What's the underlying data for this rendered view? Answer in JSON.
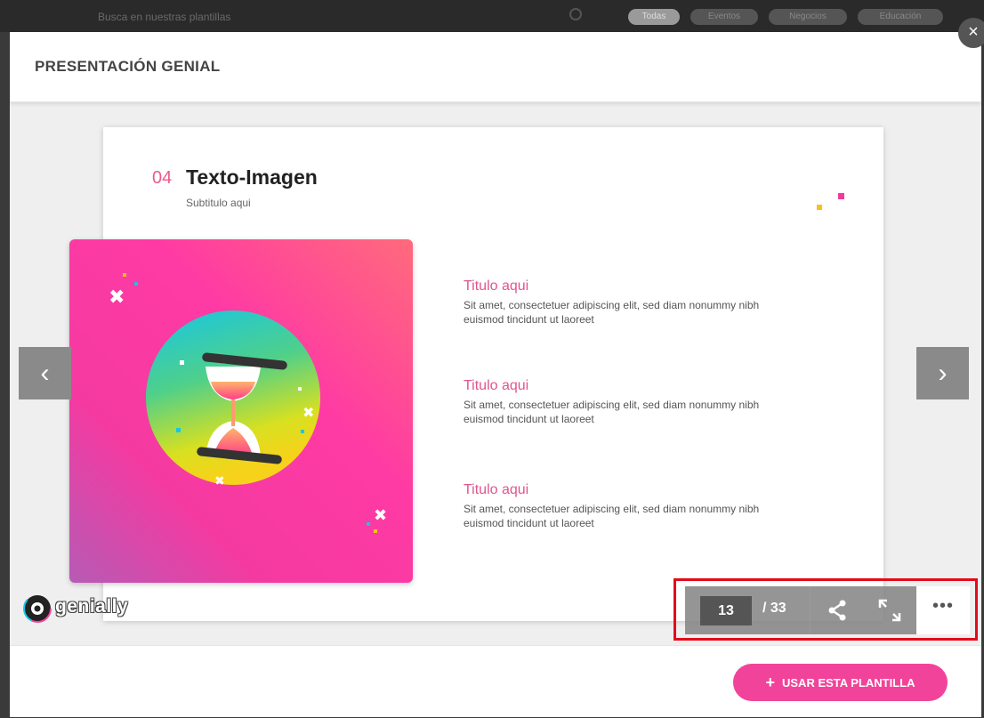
{
  "background": {
    "search_placeholder": "Busca en nuestras plantillas",
    "filters": [
      "Todas",
      "Eventos",
      "Negocios",
      "Educación"
    ]
  },
  "modal": {
    "title": "PRESENTACIÓN GENIAL",
    "close_label": "×"
  },
  "slide": {
    "number": "04",
    "heading": "Texto-Imagen",
    "subtitle": "Subtitulo aqui",
    "items": [
      {
        "title": "Titulo aqui",
        "body": "Sit amet, consectetuer adipiscing elit, sed diam nonummy nibh euismod tincidunt ut laoreet"
      },
      {
        "title": "Titulo aqui",
        "body": "Sit amet, consectetuer adipiscing elit, sed diam nonummy nibh euismod tincidunt ut laoreet"
      },
      {
        "title": "Titulo aqui",
        "body": "Sit amet, consectetuer adipiscing elit, sed diam nonummy nibh euismod tincidunt ut laoreet"
      }
    ]
  },
  "nav": {
    "prev_icon": "‹",
    "next_icon": "›"
  },
  "logo": {
    "text": "genially"
  },
  "toolbar": {
    "current_page": "13",
    "total_pages": "/ 33",
    "more_label": "•••"
  },
  "footer": {
    "use_template_plus": "+",
    "use_template_label": "USAR ESTA PLANTILLA"
  },
  "colors": {
    "accent_pink": "#f2439a",
    "highlight_red": "#e30b1a"
  }
}
